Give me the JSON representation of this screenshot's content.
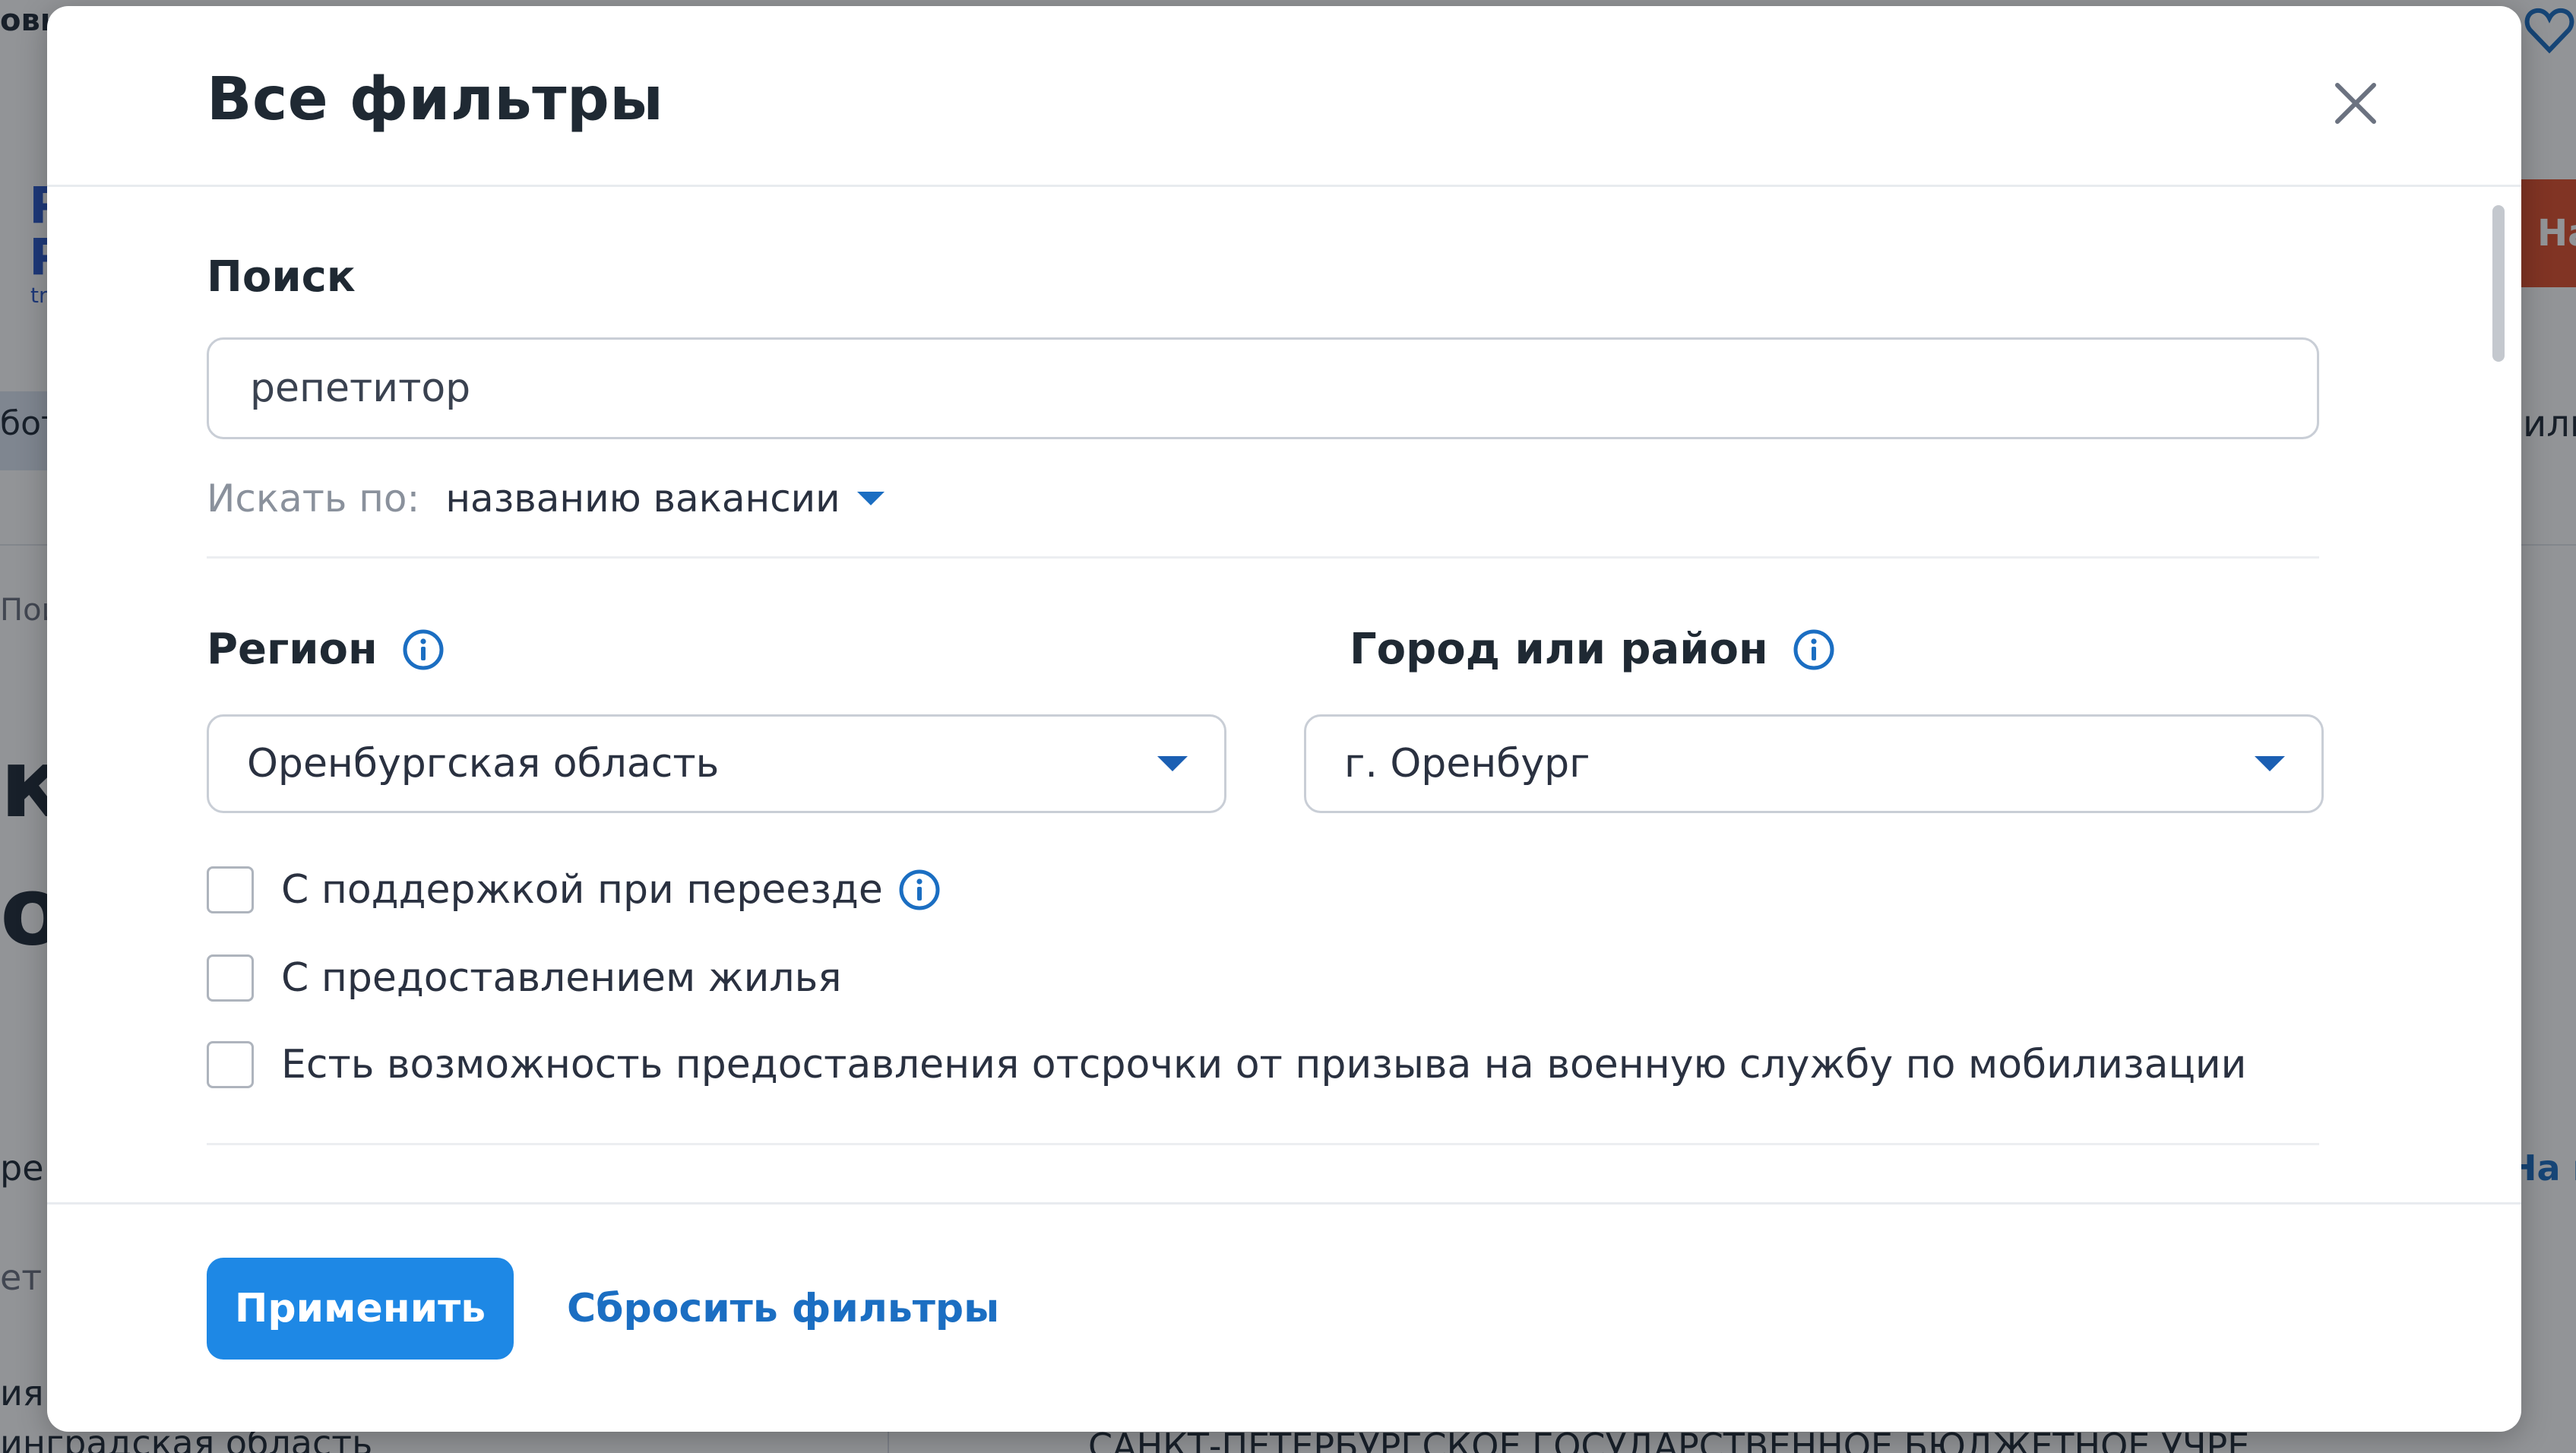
{
  "background": {
    "left_top_text": "овь",
    "left_logo_letters": [
      "Р",
      "Р"
    ],
    "left_logo_small": "tr",
    "left_nav_text": "бот",
    "left_breadcrumb": "Пои",
    "left_heading_1": "к",
    "left_heading_2": "ос",
    "left_text_1": "ре",
    "left_text_2": "ет",
    "left_text_3": "ия",
    "left_bottom_text": "инградская область",
    "right_button_label": "На",
    "right_text": "или",
    "right_link": "На н",
    "bottom_org_text": "САНКТ-ПЕТЕРБУРГСКОЕ ГОСУДАРСТВЕННОЕ БЮДЖЕТНОЕ УЧРЕ"
  },
  "modal": {
    "title": "Все фильтры",
    "close_icon": "close-icon",
    "search": {
      "label": "Поиск",
      "value": "репетитор",
      "search_by_label": "Искать по:",
      "search_by_value": "названию вакансии"
    },
    "region": {
      "label": "Регион",
      "value": "Оренбургская область"
    },
    "city": {
      "label": "Город или район",
      "value": "г. Оренбург"
    },
    "checkboxes": [
      {
        "label": "С поддержкой при переезде",
        "checked": false,
        "has_info": true
      },
      {
        "label": "С предоставлением жилья",
        "checked": false,
        "has_info": false
      },
      {
        "label": "Есть возможность предоставления отсрочки от призыва на военную службу по мобилизации",
        "checked": false,
        "has_info": false
      }
    ],
    "footer": {
      "apply_label": "Применить",
      "reset_label": "Сбросить фильтры"
    }
  },
  "colors": {
    "accent": "#1e88e5",
    "link": "#1b6ec2",
    "overlay": "rgba(18,22,28,0.46)"
  }
}
